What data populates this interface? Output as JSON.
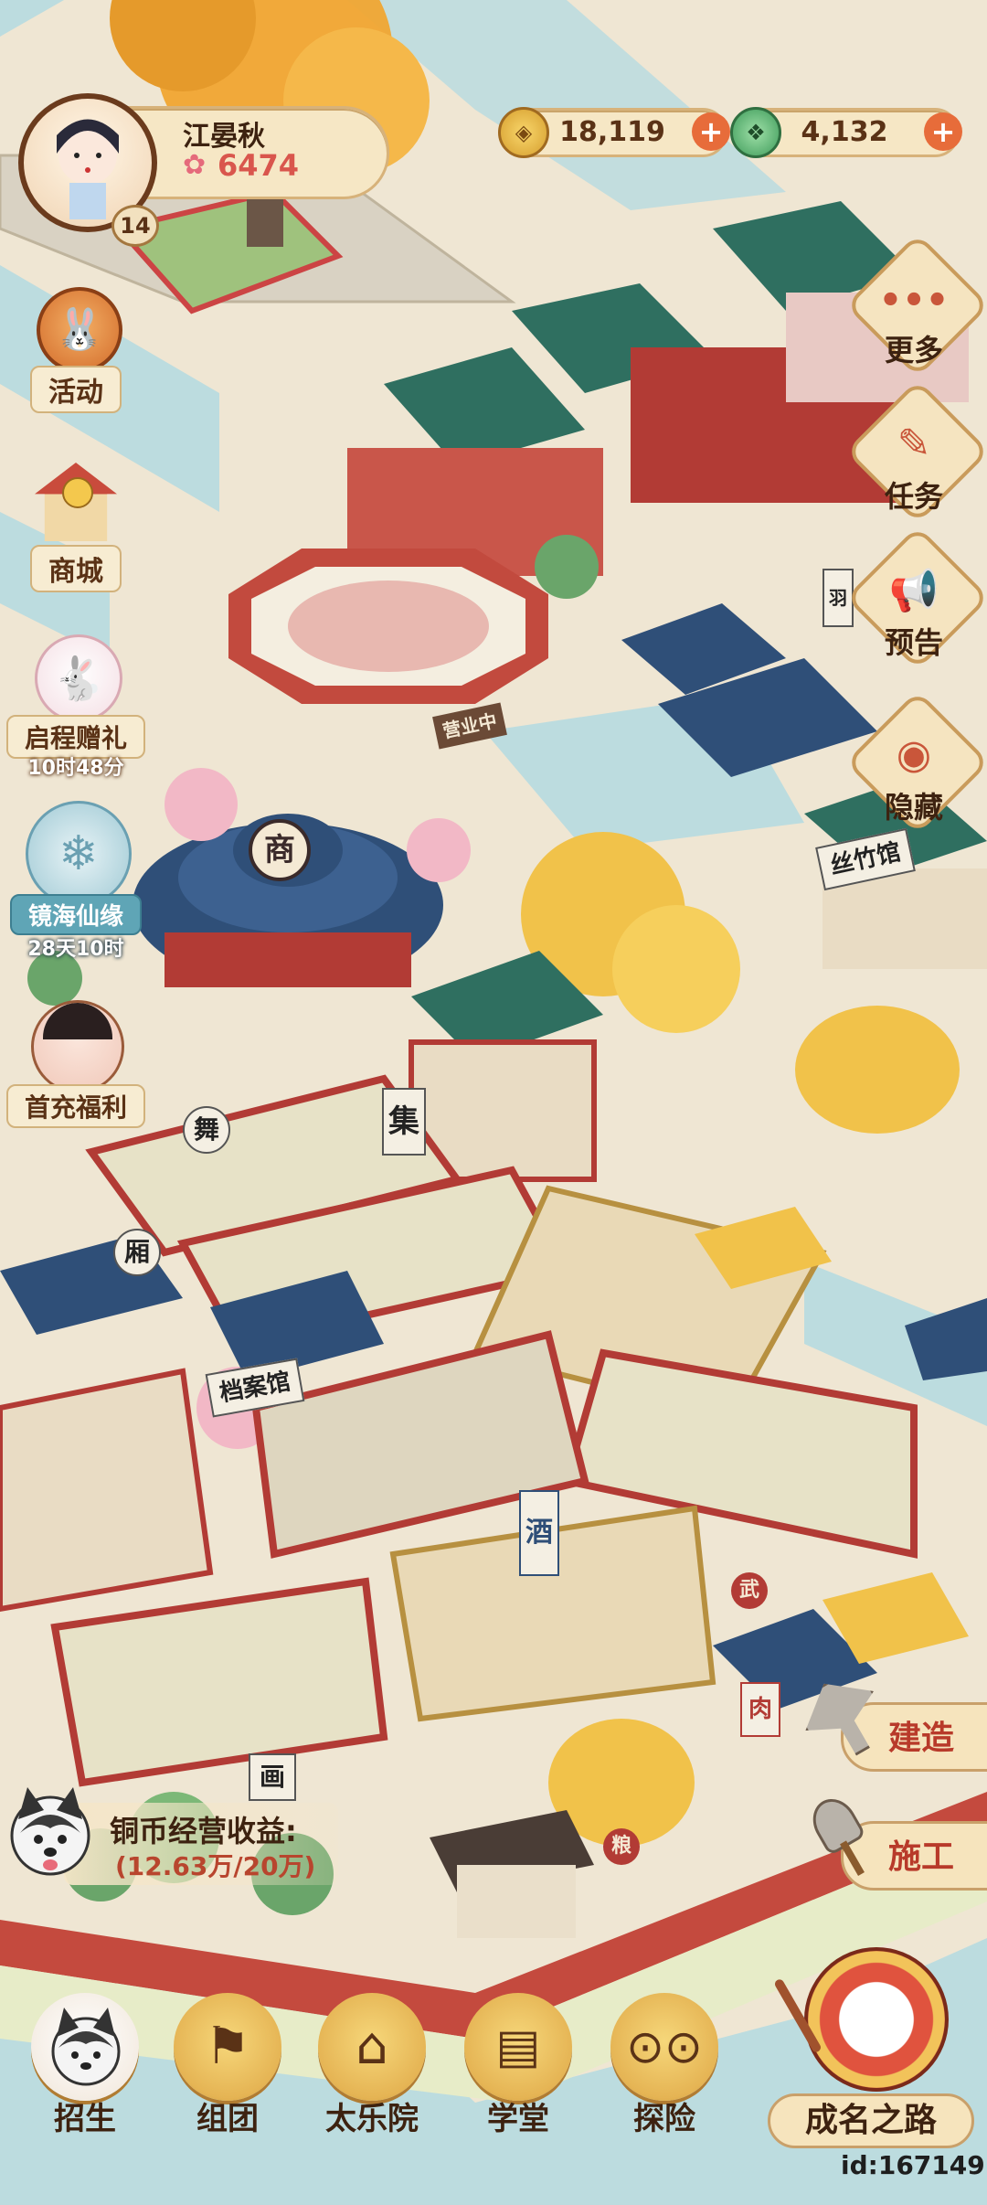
{
  "player": {
    "name": "江晏秋",
    "score": "6474",
    "level": "14"
  },
  "currencies": {
    "coins": "18,119",
    "jade": "4,132"
  },
  "left_menu": {
    "activity": "活动",
    "shop": "商城",
    "gift": "启程赠礼",
    "gift_timer": "10时48分",
    "event": "镜海仙缘",
    "event_timer": "28天10时",
    "first_recharge": "首充福利"
  },
  "right_menu": {
    "more": "更多",
    "task": "任务",
    "notice": "预告",
    "hide": "隐藏"
  },
  "actions": {
    "build": "建造",
    "construct": "施工"
  },
  "income": {
    "title": "铜币经营收益:",
    "value": "(12.63万/20万)"
  },
  "bottom_nav": {
    "recruit": "招生",
    "team": "组团",
    "music_hall": "太乐院",
    "school": "学堂",
    "explore": "探险",
    "fame_road": "成名之路"
  },
  "map_signs": {
    "shang": "商",
    "ji": "集",
    "jiu": "酒",
    "archive": "档案馆",
    "silk_bamboo": "丝竹馆",
    "wu": "舞",
    "xiang": "厢",
    "hua": "画",
    "rou": "肉",
    "liang": "粮",
    "wu2": "武",
    "yingye": "营业中",
    "yu": "羽"
  },
  "footer": {
    "id": "id:167149"
  },
  "colors": {
    "water": "#bcdcdf",
    "ground": "#efe6d3",
    "roof_green": "#2f6f60",
    "roof_blue": "#2f4f78",
    "wall_red": "#b23b35",
    "tree_orange": "#f0a531",
    "ui_gold": "#e5b454",
    "ui_text": "#5a3216"
  }
}
